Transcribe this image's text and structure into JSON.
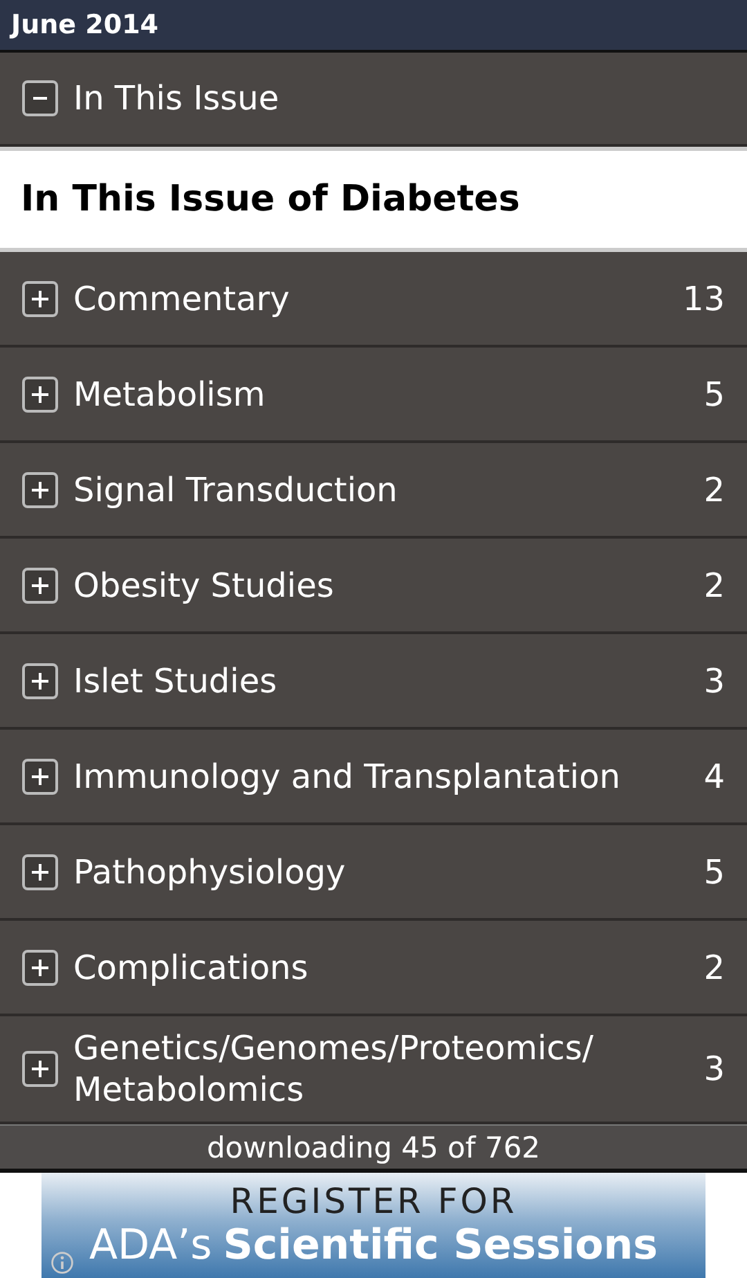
{
  "title_bar": {
    "title": "June 2014"
  },
  "section": {
    "label": "In This Issue",
    "expanded": true
  },
  "issue_heading": "In This Issue of Diabetes",
  "categories": [
    {
      "label": "Commentary",
      "count": "13",
      "expanded": false
    },
    {
      "label": "Metabolism",
      "count": "5",
      "expanded": false
    },
    {
      "label": "Signal Transduction",
      "count": "2",
      "expanded": false
    },
    {
      "label": "Obesity Studies",
      "count": "2",
      "expanded": false
    },
    {
      "label": "Islet Studies",
      "count": "3",
      "expanded": false
    },
    {
      "label": "Immunology and Transplantation",
      "count": "4",
      "expanded": false
    },
    {
      "label": "Pathophysiology",
      "count": "5",
      "expanded": false
    },
    {
      "label": "Complications",
      "count": "2",
      "expanded": false
    },
    {
      "label": "Genetics/Genomes/Proteomics/ Metabolomics",
      "count": "3",
      "expanded": false
    }
  ],
  "status": "downloading 45 of 762",
  "ad": {
    "line_1": "REGISTER FOR",
    "line_2_prefix": "ADA’s",
    "line_2_bold": "Scientific Sessions"
  }
}
